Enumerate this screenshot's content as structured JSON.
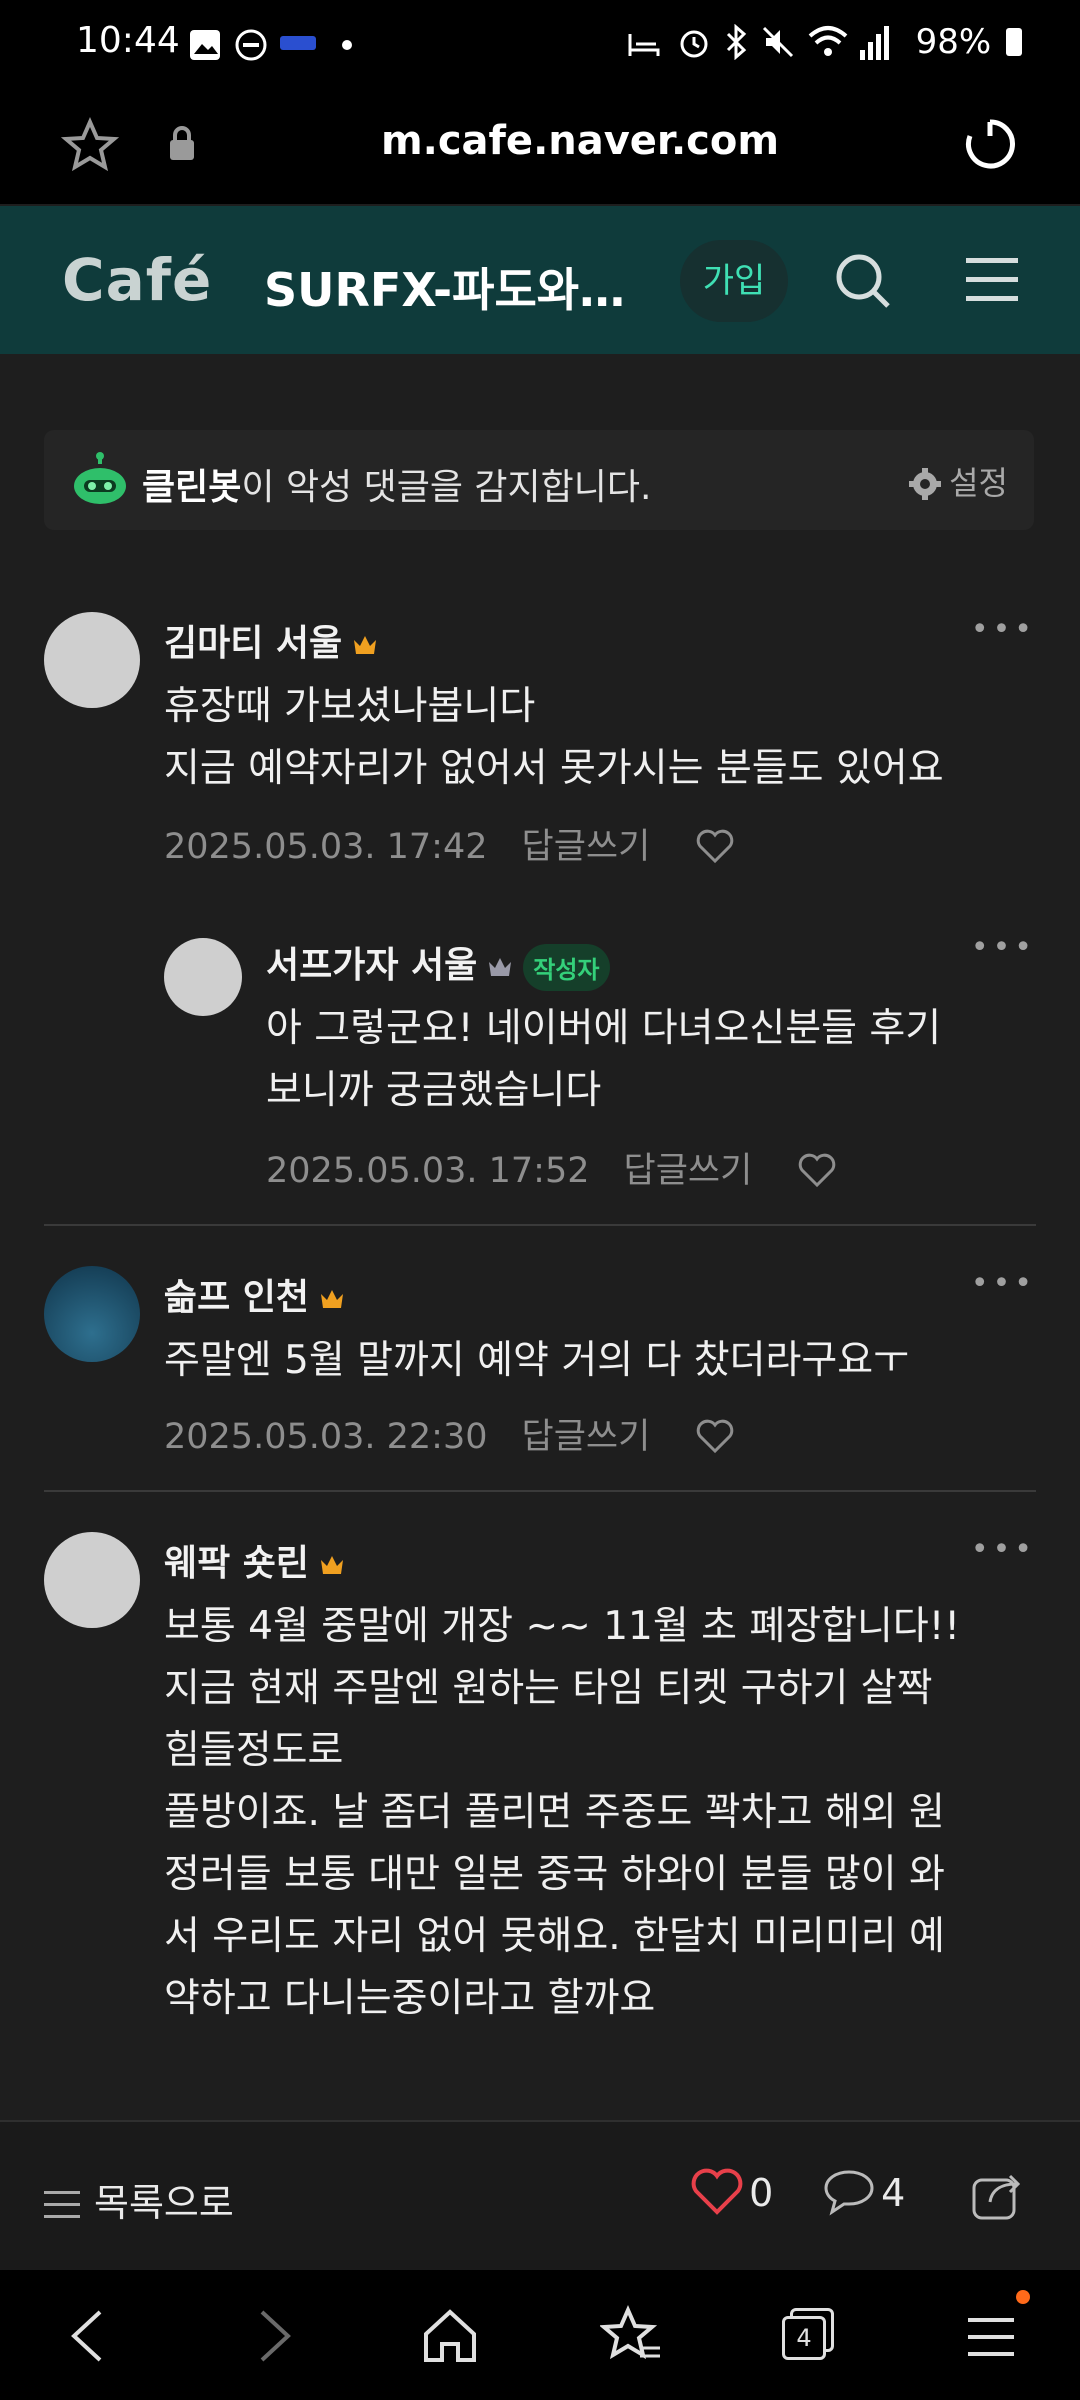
{
  "status_bar": {
    "time": "10:44",
    "battery": "98%"
  },
  "browser": {
    "url": "m.cafe.naver.com"
  },
  "header": {
    "logo": "Café",
    "title": "SURFX-파도와사...",
    "join_label": "가입"
  },
  "cleanbot": {
    "name": "클린봇",
    "message": "이 악성 댓글을 감지합니다.",
    "settings_label": "설정"
  },
  "comments": [
    {
      "author": "김마티 서울",
      "lines": [
        "휴장때 가보셨나봅니다",
        "지금 예약자리가 없어서 못가시는 분들도 있어요"
      ],
      "date": "2025.05.03. 17:42",
      "reply_label": "답글쓰기"
    },
    {
      "author": "서프가자 서울",
      "badge": "작성자",
      "lines": [
        "아 그렇군요! 네이버에 다녀오신분들 후기",
        "보니까 궁금했습니다"
      ],
      "date": "2025.05.03. 17:52",
      "reply_label": "답글쓰기"
    },
    {
      "author": "슮프 인천",
      "lines": [
        "주말엔 5월 말까지 예약 거의 다 찼더라구요ㅜ"
      ],
      "date": "2025.05.03. 22:30",
      "reply_label": "답글쓰기"
    },
    {
      "author": "웨팍 숏린",
      "lines": [
        "보통 4월 중말에 개장 ~~ 11월 초 폐장합니다!!",
        "지금 현재 주말엔 원하는 타임 티켓 구하기 살짝",
        "힘들정도로",
        "풀방이죠. 날 좀더 풀리면 주중도 꽉차고 해외 원",
        "정러들 보통 대만 일본 중국 하와이 분들 많이 와",
        "서 우리도 자리 없어 못해요. 한달치 미리미리 예",
        "약하고 다니는중이라고 할까요"
      ]
    }
  ],
  "action_bar": {
    "list_label": "목록으로",
    "likes": "0",
    "comments": "4"
  },
  "nav": {
    "tabs_count": "4"
  },
  "colors": {
    "header_bg": "#0f3b3b",
    "join_text": "#3fe0b4",
    "crown": "#f0a020",
    "heart": "#e8404a"
  }
}
